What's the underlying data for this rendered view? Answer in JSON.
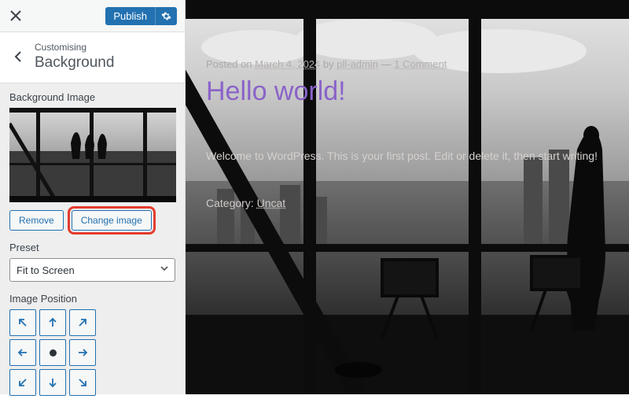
{
  "sidebar": {
    "publish_label": "Publish",
    "breadcrumb_small": "Customising",
    "breadcrumb_big": "Background",
    "bg_image_title": "Background Image",
    "remove_label": "Remove",
    "change_label": "Change image",
    "preset_title": "Preset",
    "preset_value": "Fit to Screen",
    "position_title": "Image Position"
  },
  "preview": {
    "meta_prefix": "Posted on ",
    "meta_date": "March 4, 2024",
    "meta_by": " by ",
    "meta_author": "pll-admin",
    "meta_sep": " — ",
    "meta_comments": "1 Comment",
    "title": "Hello world!",
    "body": "Welcome to WordPress. This is your first post. Edit or delete it, then start writing!",
    "cat_label": "Category: ",
    "cat_value": "Uncat"
  }
}
